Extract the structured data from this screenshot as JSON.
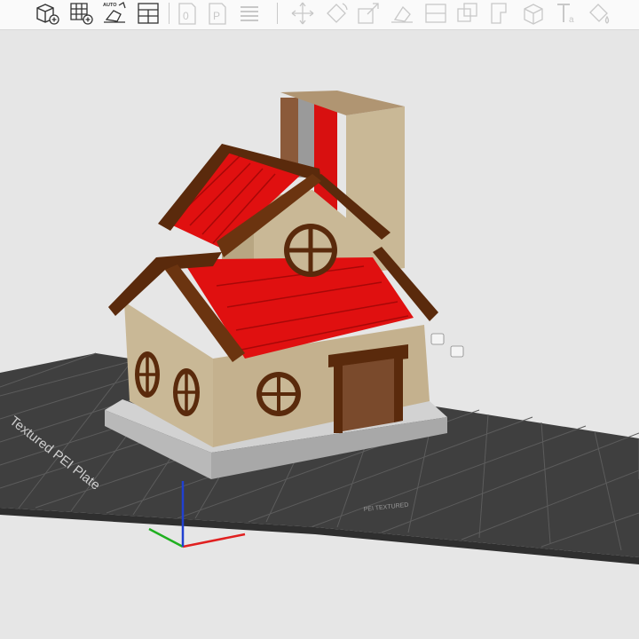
{
  "toolbar": {
    "auto_label": "AUTO",
    "buttons": [
      {
        "name": "add-shape-icon",
        "enabled": true
      },
      {
        "name": "arrange-grid-icon",
        "enabled": true
      },
      {
        "name": "auto-orient-icon",
        "enabled": true
      },
      {
        "name": "layout-panels-icon",
        "enabled": true
      },
      {
        "name": "object-0-icon",
        "enabled": false
      },
      {
        "name": "object-p-icon",
        "enabled": false
      },
      {
        "name": "layers-icon",
        "enabled": false
      },
      {
        "name": "move-icon",
        "enabled": false
      },
      {
        "name": "rotate-icon",
        "enabled": false
      },
      {
        "name": "scale-icon",
        "enabled": false
      },
      {
        "name": "lay-on-face-icon",
        "enabled": false
      },
      {
        "name": "cut-icon",
        "enabled": false
      },
      {
        "name": "boolean-icon",
        "enabled": false
      },
      {
        "name": "support-paint-icon",
        "enabled": false
      },
      {
        "name": "seam-paint-icon",
        "enabled": false
      },
      {
        "name": "text-tool-icon",
        "enabled": false
      },
      {
        "name": "color-paint-icon",
        "enabled": false
      }
    ]
  },
  "plate": {
    "label": "Textured PEI Plate",
    "brand": "PEI TEXTURED"
  },
  "colors": {
    "background": "#e6e6e6",
    "bed": "#3f3f3f",
    "grid": "#5a5a5a",
    "roof_red": "#e01010",
    "roof_trim": "#5a2a0c",
    "wall": "#c9b896",
    "door": "#7a4a2c",
    "base": "#bdbdbd",
    "chimney_brown": "#8b5a3a",
    "axis_x": "#e02020",
    "axis_y": "#20b020",
    "axis_z": "#2040d0"
  }
}
